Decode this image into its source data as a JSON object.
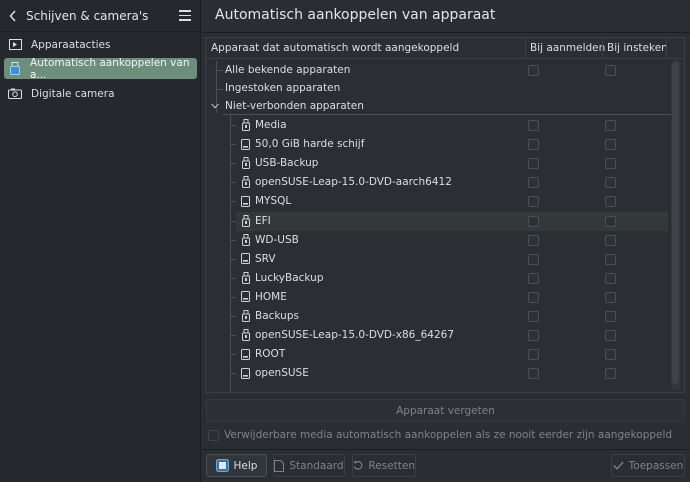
{
  "sidebar": {
    "title": "Schijven & camera's",
    "items": [
      {
        "label": "Apparaatacties",
        "icon": "device-actions-icon"
      },
      {
        "label": "Automatisch aankoppelen van a...",
        "icon": "usb-mount-icon",
        "active": true
      },
      {
        "label": "Digitale camera",
        "icon": "camera-icon"
      }
    ]
  },
  "header": {
    "title": "Automatisch aankoppelen van apparaat"
  },
  "tree": {
    "columns": [
      "Apparaat dat automatisch wordt aangekoppeld",
      "Bij aanmelden",
      "Bij insteken"
    ],
    "top": [
      {
        "label": "Alle bekende apparaten",
        "checks": true
      },
      {
        "label": "Ingestoken apparaten",
        "checks": false
      },
      {
        "label": "Niet-verbonden apparaten",
        "checks": false,
        "expanded": true
      }
    ],
    "devices": [
      {
        "label": "Media",
        "icon": "usb-drive-icon"
      },
      {
        "label": "50,0 GiB harde schijf",
        "icon": "hard-disk-icon"
      },
      {
        "label": "USB-Backup",
        "icon": "usb-drive-icon"
      },
      {
        "label": "openSUSE-Leap-15.0-DVD-aarch6412",
        "icon": "usb-drive-icon"
      },
      {
        "label": "MYSQL",
        "icon": "hard-disk-icon"
      },
      {
        "label": "EFI",
        "icon": "usb-drive-icon",
        "selected": true
      },
      {
        "label": "WD-USB",
        "icon": "usb-drive-icon"
      },
      {
        "label": "SRV",
        "icon": "hard-disk-icon"
      },
      {
        "label": "LuckyBackup",
        "icon": "usb-drive-icon"
      },
      {
        "label": "HOME",
        "icon": "hard-disk-icon"
      },
      {
        "label": "Backups",
        "icon": "usb-drive-icon"
      },
      {
        "label": "openSUSE-Leap-15.0-DVD-x86_64267",
        "icon": "usb-drive-icon"
      },
      {
        "label": "ROOT",
        "icon": "hard-disk-icon"
      },
      {
        "label": "openSUSE",
        "icon": "hard-disk-icon"
      }
    ]
  },
  "forget_button": "Apparaat vergeten",
  "auto_mount_checkbox": "Verwijderbare media automatisch aankoppelen als ze nooit eerder zijn aangekoppeld",
  "footer": {
    "help": "Help",
    "defaults": "Standaard",
    "reset": "Resetten",
    "apply": "Toepassen"
  },
  "colors": {
    "accent_selected": "#6c8f7c",
    "background": "#2a2e32"
  }
}
